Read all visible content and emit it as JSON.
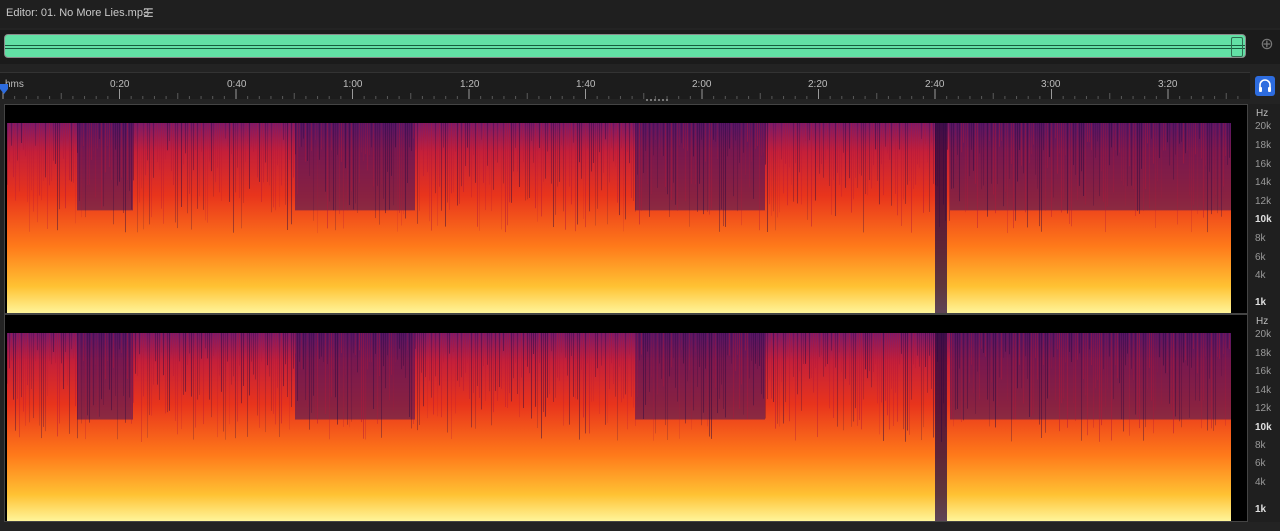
{
  "editor": {
    "title": "Editor: 01. No More Lies.mp3",
    "menu_icon": "hamburger-menu-icon"
  },
  "timeline": {
    "unit_label": "hms",
    "labels": [
      "0:20",
      "0:40",
      "1:00",
      "1:20",
      "1:40",
      "2:00",
      "2:20",
      "2:40",
      "3:00",
      "3:20"
    ]
  },
  "frequency_scale": {
    "unit": "Hz",
    "labels": [
      "20k",
      "18k",
      "16k",
      "14k",
      "12k",
      "10k",
      "8k",
      "6k",
      "4k",
      "1k"
    ],
    "bold_labels": [
      "10k",
      "1k"
    ]
  },
  "colors": {
    "overview_wave": "#62e0a5",
    "accent": "#2d6cdf",
    "spectrum_low": "#ffe36b",
    "spectrum_mid": "#e8341c",
    "spectrum_high": "#4a1a7a"
  },
  "icons": {
    "zoom": "zoom-navigator-icon",
    "headphones": "headphones-icon",
    "playhead": "playhead-marker-icon"
  }
}
